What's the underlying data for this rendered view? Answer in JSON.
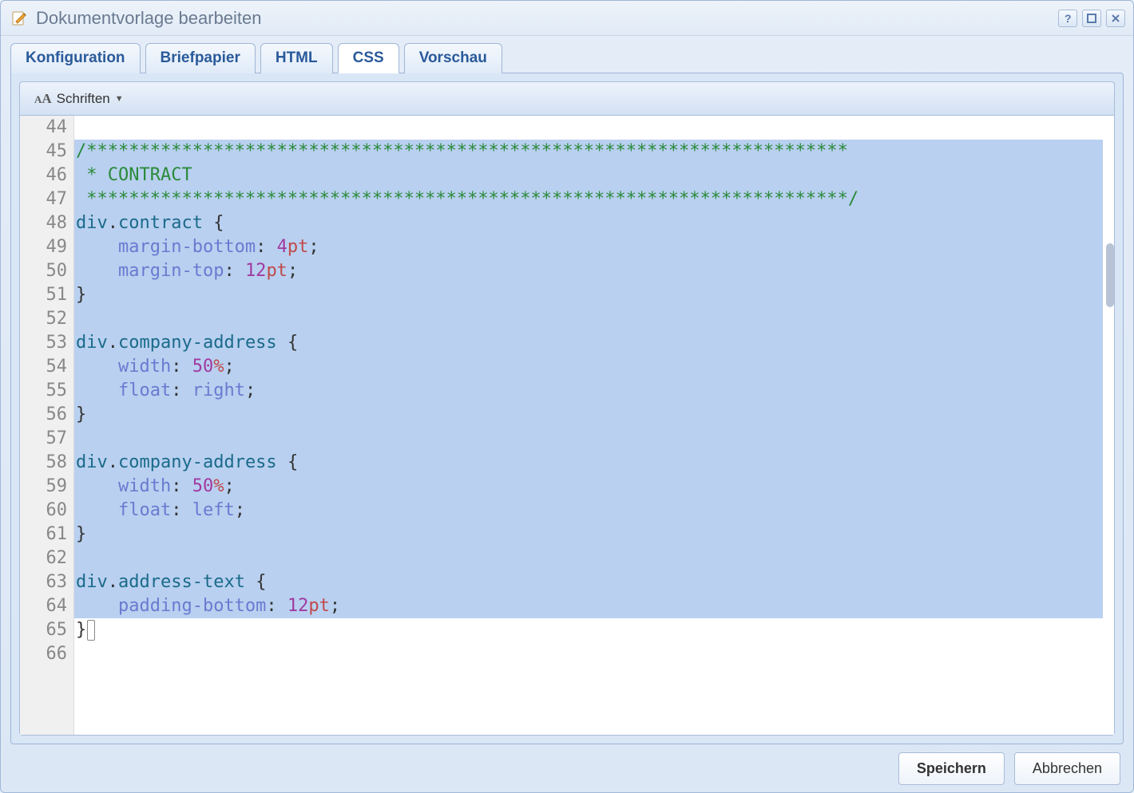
{
  "window": {
    "title": "Dokumentvorlage bearbeiten"
  },
  "tabs": [
    {
      "label": "Konfiguration",
      "active": false
    },
    {
      "label": "Briefpapier",
      "active": false
    },
    {
      "label": "HTML",
      "active": false
    },
    {
      "label": "CSS",
      "active": true
    },
    {
      "label": "Vorschau",
      "active": false
    }
  ],
  "toolbar": {
    "fonts_label": "Schriften"
  },
  "editor": {
    "first_line": 44,
    "selection_start": 45,
    "selection_end": 64,
    "lines": [
      {
        "n": 44,
        "tokens": []
      },
      {
        "n": 45,
        "tokens": [
          {
            "t": "/************************************************************************",
            "c": "comment"
          }
        ]
      },
      {
        "n": 46,
        "tokens": [
          {
            "t": " * CONTRACT",
            "c": "comment"
          }
        ]
      },
      {
        "n": 47,
        "tokens": [
          {
            "t": " ************************************************************************/",
            "c": "comment"
          }
        ]
      },
      {
        "n": 48,
        "tokens": [
          {
            "t": "div",
            "c": "tag"
          },
          {
            "t": ".",
            "c": "punc"
          },
          {
            "t": "contract",
            "c": "class"
          },
          {
            "t": " ",
            "c": ""
          },
          {
            "t": "{",
            "c": "brace"
          }
        ]
      },
      {
        "n": 49,
        "tokens": [
          {
            "t": "    ",
            "c": ""
          },
          {
            "t": "margin-bottom",
            "c": "prop"
          },
          {
            "t": ": ",
            "c": "punc"
          },
          {
            "t": "4",
            "c": "num"
          },
          {
            "t": "pt",
            "c": "unit"
          },
          {
            "t": ";",
            "c": "punc"
          }
        ]
      },
      {
        "n": 50,
        "tokens": [
          {
            "t": "    ",
            "c": ""
          },
          {
            "t": "margin-top",
            "c": "prop"
          },
          {
            "t": ": ",
            "c": "punc"
          },
          {
            "t": "12",
            "c": "num"
          },
          {
            "t": "pt",
            "c": "unit"
          },
          {
            "t": ";",
            "c": "punc"
          }
        ]
      },
      {
        "n": 51,
        "tokens": [
          {
            "t": "}",
            "c": "brace"
          }
        ]
      },
      {
        "n": 52,
        "tokens": []
      },
      {
        "n": 53,
        "tokens": [
          {
            "t": "div",
            "c": "tag"
          },
          {
            "t": ".",
            "c": "punc"
          },
          {
            "t": "company-address",
            "c": "class"
          },
          {
            "t": " ",
            "c": ""
          },
          {
            "t": "{",
            "c": "brace"
          }
        ]
      },
      {
        "n": 54,
        "tokens": [
          {
            "t": "    ",
            "c": ""
          },
          {
            "t": "width",
            "c": "prop"
          },
          {
            "t": ": ",
            "c": "punc"
          },
          {
            "t": "50",
            "c": "num"
          },
          {
            "t": "%",
            "c": "unit"
          },
          {
            "t": ";",
            "c": "punc"
          }
        ]
      },
      {
        "n": 55,
        "tokens": [
          {
            "t": "    ",
            "c": ""
          },
          {
            "t": "float",
            "c": "prop"
          },
          {
            "t": ": ",
            "c": "punc"
          },
          {
            "t": "right",
            "c": "kw"
          },
          {
            "t": ";",
            "c": "punc"
          }
        ]
      },
      {
        "n": 56,
        "tokens": [
          {
            "t": "}",
            "c": "brace"
          }
        ]
      },
      {
        "n": 57,
        "tokens": []
      },
      {
        "n": 58,
        "tokens": [
          {
            "t": "div",
            "c": "tag"
          },
          {
            "t": ".",
            "c": "punc"
          },
          {
            "t": "company-address",
            "c": "class"
          },
          {
            "t": " ",
            "c": ""
          },
          {
            "t": "{",
            "c": "brace"
          }
        ]
      },
      {
        "n": 59,
        "tokens": [
          {
            "t": "    ",
            "c": ""
          },
          {
            "t": "width",
            "c": "prop"
          },
          {
            "t": ": ",
            "c": "punc"
          },
          {
            "t": "50",
            "c": "num"
          },
          {
            "t": "%",
            "c": "unit"
          },
          {
            "t": ";",
            "c": "punc"
          }
        ]
      },
      {
        "n": 60,
        "tokens": [
          {
            "t": "    ",
            "c": ""
          },
          {
            "t": "float",
            "c": "prop"
          },
          {
            "t": ": ",
            "c": "punc"
          },
          {
            "t": "left",
            "c": "kw"
          },
          {
            "t": ";",
            "c": "punc"
          }
        ]
      },
      {
        "n": 61,
        "tokens": [
          {
            "t": "}",
            "c": "brace"
          }
        ]
      },
      {
        "n": 62,
        "tokens": []
      },
      {
        "n": 63,
        "tokens": [
          {
            "t": "div",
            "c": "tag"
          },
          {
            "t": ".",
            "c": "punc"
          },
          {
            "t": "address-text",
            "c": "class"
          },
          {
            "t": " ",
            "c": ""
          },
          {
            "t": "{",
            "c": "brace"
          }
        ]
      },
      {
        "n": 64,
        "tokens": [
          {
            "t": "    ",
            "c": ""
          },
          {
            "t": "padding-bottom",
            "c": "prop"
          },
          {
            "t": ": ",
            "c": "punc"
          },
          {
            "t": "12",
            "c": "num"
          },
          {
            "t": "pt",
            "c": "unit"
          },
          {
            "t": ";",
            "c": "punc"
          }
        ]
      },
      {
        "n": 65,
        "tokens": [
          {
            "t": "}",
            "c": "brace"
          }
        ]
      },
      {
        "n": 66,
        "tokens": []
      }
    ]
  },
  "footer": {
    "save_label": "Speichern",
    "cancel_label": "Abbrechen"
  }
}
